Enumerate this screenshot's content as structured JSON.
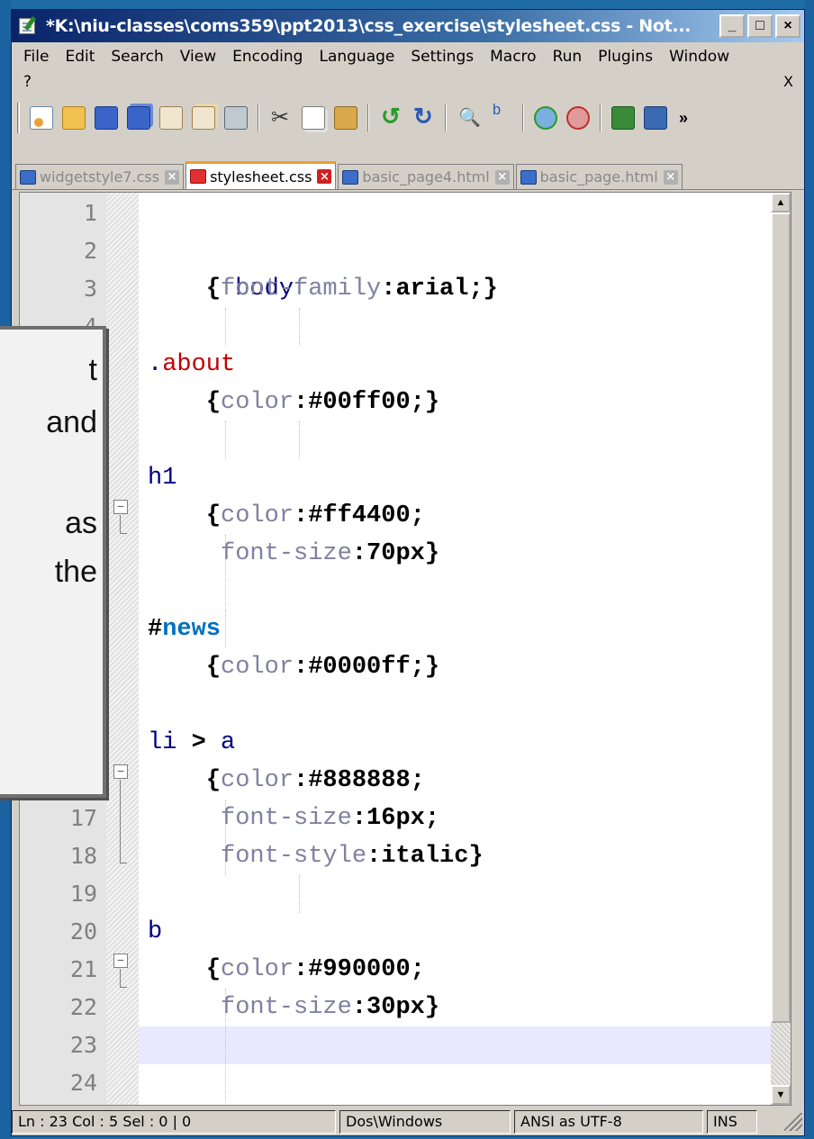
{
  "window": {
    "title": "*K:\\niu-classes\\coms359\\ppt2013\\css_exercise\\stylesheet.css - Not...",
    "buttons": {
      "minimize": "_",
      "maximize": "□",
      "close": "×"
    }
  },
  "menu": {
    "items": [
      "File",
      "Edit",
      "Search",
      "View",
      "Encoding",
      "Language",
      "Settings",
      "Macro",
      "Run",
      "Plugins",
      "Window"
    ],
    "help": "?",
    "close_doc": "X"
  },
  "toolbar": {
    "more": "»"
  },
  "tabs": [
    {
      "label": "widgetstyle7.css",
      "active": false
    },
    {
      "label": "stylesheet.css",
      "active": true
    },
    {
      "label": "basic_page4.html",
      "active": false
    },
    {
      "label": "basic_page.html",
      "active": false
    }
  ],
  "tab_close_glyph": "×",
  "editor": {
    "line_numbers": [
      "1",
      "2",
      "3",
      "4",
      "17",
      "18",
      "19",
      "20",
      "21",
      "22",
      "23",
      "24"
    ],
    "code": {
      "l2": "body",
      "l3_brace": "{",
      "l3_prop": "font-family",
      "l3_val": ":arial;}",
      "l5_dot": ".",
      "l5_cls": "about",
      "l6_brace": "{",
      "l6_prop": "color",
      "l6_val": ":#00ff00;}",
      "l8": "h1",
      "l9_brace": "{",
      "l9_prop": "color",
      "l9_val": ":#ff4400;",
      "l10_prop": "font-size",
      "l10_val": ":70px}",
      "l12_hash": "#",
      "l12_id": "news",
      "l13_brace": "{",
      "l13_prop": "color",
      "l13_val": ":#0000ff;}",
      "l15_sel": "li",
      "l15_op": " > ",
      "l15_a": "a",
      "l16_brace": "{",
      "l16_prop": "color",
      "l16_val": ":#888888;",
      "l17_prop": "font-size",
      "l17_val": ":16px;",
      "l18_prop": "font-style",
      "l18_val": ":italic}",
      "l20": "b",
      "l21_brace": "{",
      "l21_prop": "color",
      "l21_val": ":#990000;",
      "l22_prop": "font-size",
      "l22_val": ":30px}"
    },
    "current_line": "23"
  },
  "status": {
    "position": "Ln : 23   Col : 5   Sel : 0 | 0",
    "eol": "Dos\\Windows",
    "encoding": "ANSI as UTF-8",
    "mode": "INS"
  },
  "overlay": {
    "lines": [
      "t",
      "and",
      "",
      "as",
      "the"
    ]
  },
  "colors": {
    "slide_background": "#1f6ba6",
    "selector": "#000080",
    "class": "#c00000",
    "id": "#0070c0",
    "property": "#8080a0",
    "current_line": "#e8e8ff",
    "active_tab_accent": "#f0a030"
  }
}
